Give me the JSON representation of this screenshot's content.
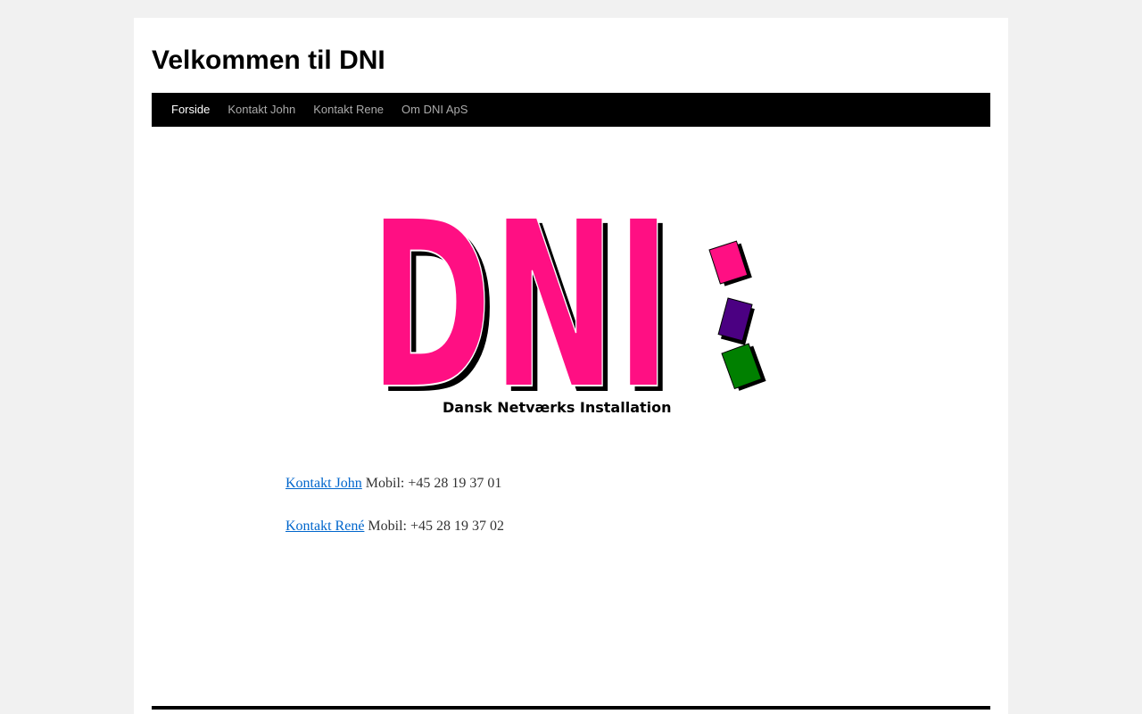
{
  "header": {
    "site_title": "Velkommen til DNI"
  },
  "nav": {
    "items": [
      {
        "label": "Forside",
        "current": true
      },
      {
        "label": "Kontakt John",
        "current": false
      },
      {
        "label": "Kontakt Rene",
        "current": false
      },
      {
        "label": "Om DNI ApS",
        "current": false
      }
    ]
  },
  "logo": {
    "text": "DNI",
    "tagline": "Dansk Netværks Installation",
    "colors": {
      "letters": "#ff0f83",
      "shadow": "#000000",
      "square_1": "#ff0f83",
      "square_2": "#4b0082",
      "square_3": "#008000"
    }
  },
  "contacts": [
    {
      "link_text": "Kontakt John",
      "phone": "Mobil: +45 28 19 37 01"
    },
    {
      "link_text": "Kontakt René",
      "phone": "Mobil: +45 28 19 37 02"
    }
  ],
  "colors": {
    "background": "#f1f1f1",
    "nav_bg": "#000000",
    "link": "#0066cc"
  }
}
